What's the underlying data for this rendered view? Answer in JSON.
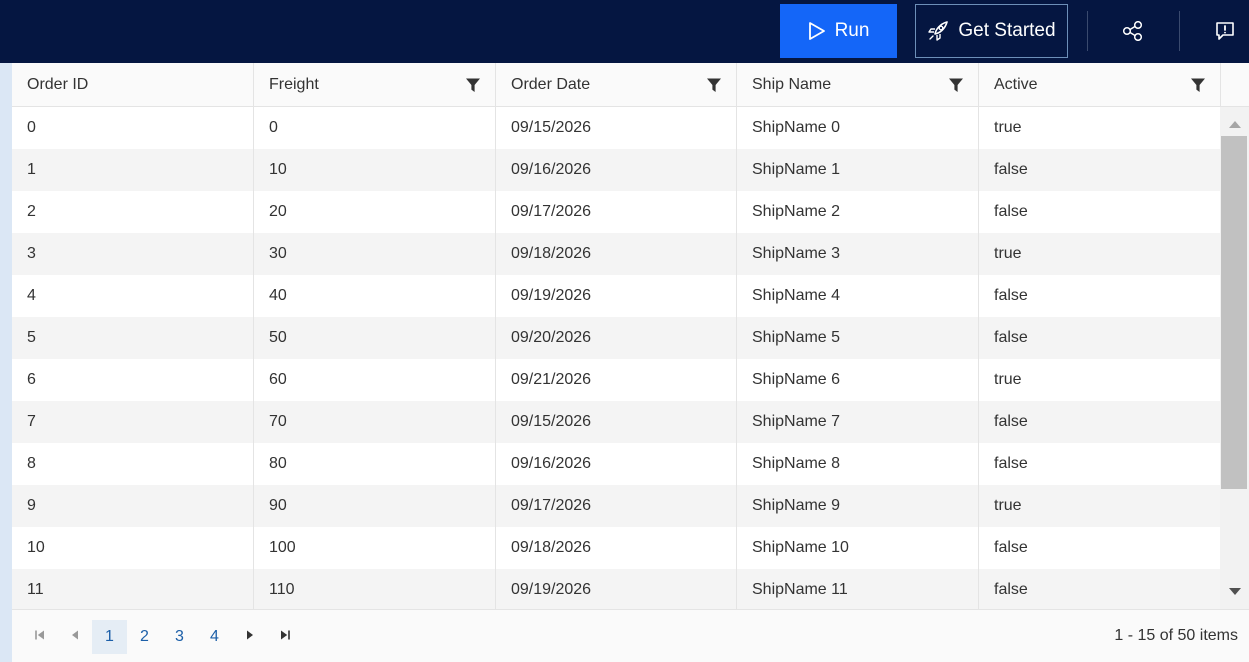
{
  "toolbar": {
    "run_label": "Run",
    "get_started_label": "Get Started"
  },
  "grid": {
    "columns": [
      "Order ID",
      "Freight",
      "Order Date",
      "Ship Name",
      "Active"
    ],
    "rows": [
      [
        "0",
        "0",
        "09/15/2026",
        "ShipName 0",
        "true"
      ],
      [
        "1",
        "10",
        "09/16/2026",
        "ShipName 1",
        "false"
      ],
      [
        "2",
        "20",
        "09/17/2026",
        "ShipName 2",
        "false"
      ],
      [
        "3",
        "30",
        "09/18/2026",
        "ShipName 3",
        "true"
      ],
      [
        "4",
        "40",
        "09/19/2026",
        "ShipName 4",
        "false"
      ],
      [
        "5",
        "50",
        "09/20/2026",
        "ShipName 5",
        "false"
      ],
      [
        "6",
        "60",
        "09/21/2026",
        "ShipName 6",
        "true"
      ],
      [
        "7",
        "70",
        "09/15/2026",
        "ShipName 7",
        "false"
      ],
      [
        "8",
        "80",
        "09/16/2026",
        "ShipName 8",
        "false"
      ],
      [
        "9",
        "90",
        "09/17/2026",
        "ShipName 9",
        "true"
      ],
      [
        "10",
        "100",
        "09/18/2026",
        "ShipName 10",
        "false"
      ],
      [
        "11",
        "110",
        "09/19/2026",
        "ShipName 11",
        "false"
      ]
    ]
  },
  "pager": {
    "pages": [
      "1",
      "2",
      "3",
      "4"
    ],
    "current": "1",
    "info": "1 - 15 of 50 items"
  },
  "colors": {
    "topbar": "#051641",
    "run_button": "#1466f8",
    "link": "#1c5fa8"
  },
  "icons": [
    "play-icon",
    "rocket-icon",
    "share-icon",
    "feedback-icon",
    "filter-icon",
    "first-page-icon",
    "prev-page-icon",
    "next-page-icon",
    "last-page-icon",
    "scroll-up-icon",
    "scroll-down-icon"
  ]
}
